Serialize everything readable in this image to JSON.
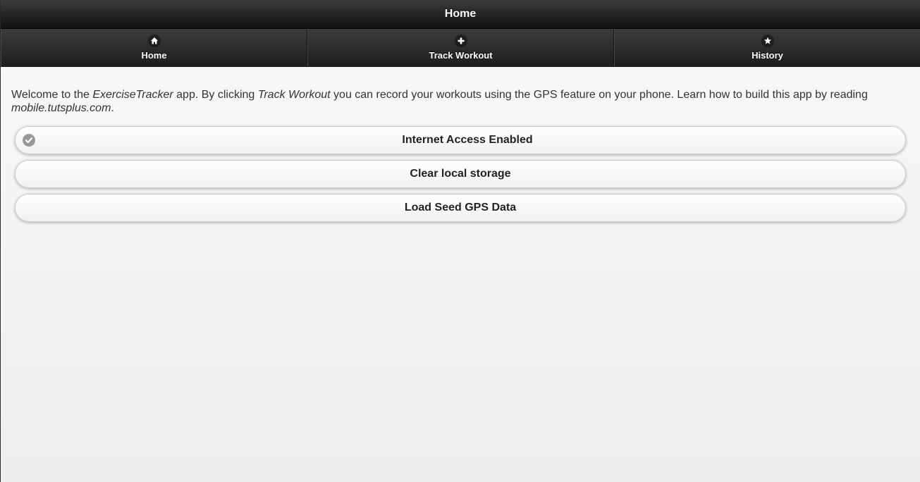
{
  "header": {
    "title": "Home"
  },
  "navbar": {
    "items": [
      {
        "label": "Home",
        "icon": "home-icon"
      },
      {
        "label": "Track Workout",
        "icon": "plus-icon"
      },
      {
        "label": "History",
        "icon": "star-icon"
      }
    ]
  },
  "intro": {
    "text_1": "Welcome to the ",
    "app_name": "ExerciseTracker",
    "text_2": " app. By clicking ",
    "link_name": "Track Workout",
    "text_3": " you can record your workouts using the GPS feature on your phone. Learn how to build this app by reading ",
    "site": "mobile.tutsplus.com",
    "text_4": "."
  },
  "buttons": {
    "internet_access": {
      "label": "Internet Access Enabled",
      "icon": "check-icon"
    },
    "clear_storage": {
      "label": "Clear local storage"
    },
    "load_seed": {
      "label": "Load Seed GPS Data"
    }
  },
  "colors": {
    "header_bg": "#1e1e1e",
    "button_bg": "#f6f6f6",
    "icon_grey": "#999999"
  }
}
